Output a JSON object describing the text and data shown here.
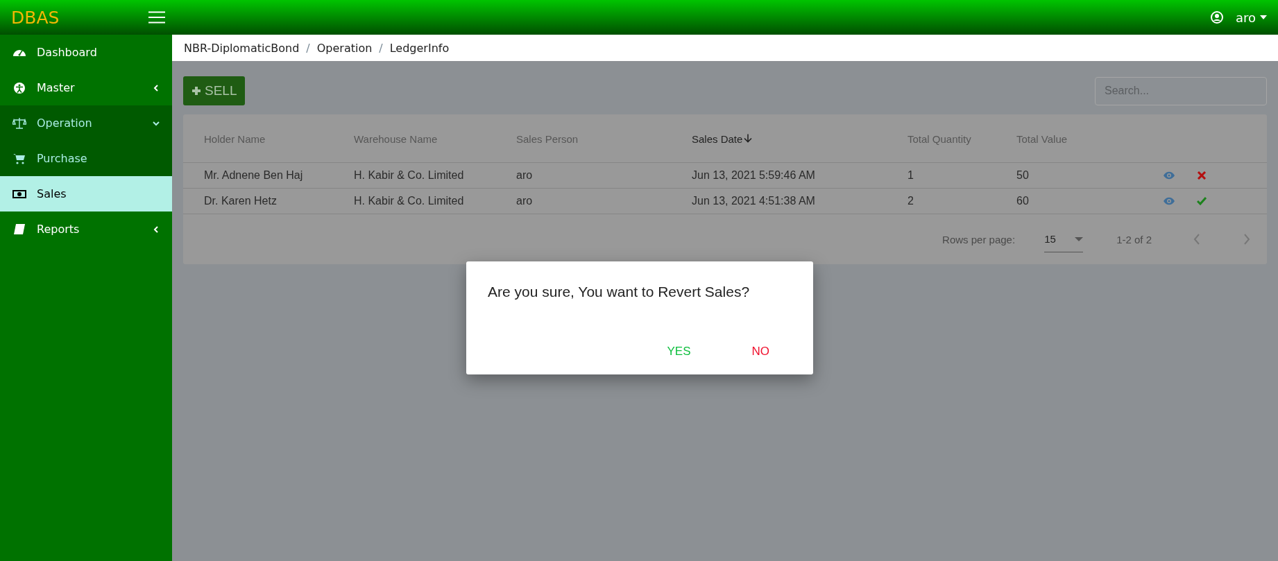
{
  "app": {
    "brand": "DBAS",
    "user": "aro"
  },
  "sidebar": {
    "items": [
      {
        "label": "Dashboard",
        "kind": "link",
        "selected": false
      },
      {
        "label": "Master",
        "kind": "group",
        "expanded": false,
        "selected": false
      },
      {
        "label": "Operation",
        "kind": "group",
        "expanded": true,
        "selected": false,
        "children": [
          {
            "label": "Purchase",
            "selected": false
          },
          {
            "label": "Sales",
            "selected": true
          }
        ]
      },
      {
        "label": "Reports",
        "kind": "group",
        "expanded": false,
        "selected": false
      }
    ]
  },
  "breadcrumb": [
    {
      "text": "NBR-DiplomaticBond",
      "kind": "link"
    },
    {
      "text": "/",
      "kind": "separator"
    },
    {
      "text": "Operation",
      "kind": "link"
    },
    {
      "text": "/",
      "kind": "separator"
    },
    {
      "text": "LedgerInfo",
      "kind": "link"
    }
  ],
  "toolbar": {
    "add_button": "SELL",
    "search": {
      "placeholder": "Search..."
    }
  },
  "table": {
    "columns": [
      {
        "label": "Holder Name",
        "sorted": false
      },
      {
        "label": "Warehouse Name",
        "sorted": false
      },
      {
        "label": "Sales Person",
        "sorted": false
      },
      {
        "label": "Sales Date",
        "sorted": true
      },
      {
        "label": "Total Quantity",
        "sorted": false
      },
      {
        "label": "Total Value",
        "sorted": false
      }
    ],
    "rows": [
      {
        "cells": [
          "Mr. Adnene Ben Haj",
          "H. Kabir & Co. Limited",
          "aro",
          "Jun 13, 2021 5:59:46 AM",
          "1",
          "50"
        ],
        "confirmed": false
      },
      {
        "cells": [
          "Dr. Karen Hetz",
          "H. Kabir & Co. Limited",
          "aro",
          "Jun 13, 2021 4:51:38 AM",
          "2",
          "60"
        ],
        "confirmed": true
      }
    ],
    "pagination": {
      "rows_per_page_label": "Rows per page:",
      "rows_per_page": "15",
      "range": "1-2 of 2"
    }
  },
  "dialog": {
    "message": "Are you sure, You want to Revert Sales?",
    "confirm": "YES",
    "cancel": "NO"
  }
}
